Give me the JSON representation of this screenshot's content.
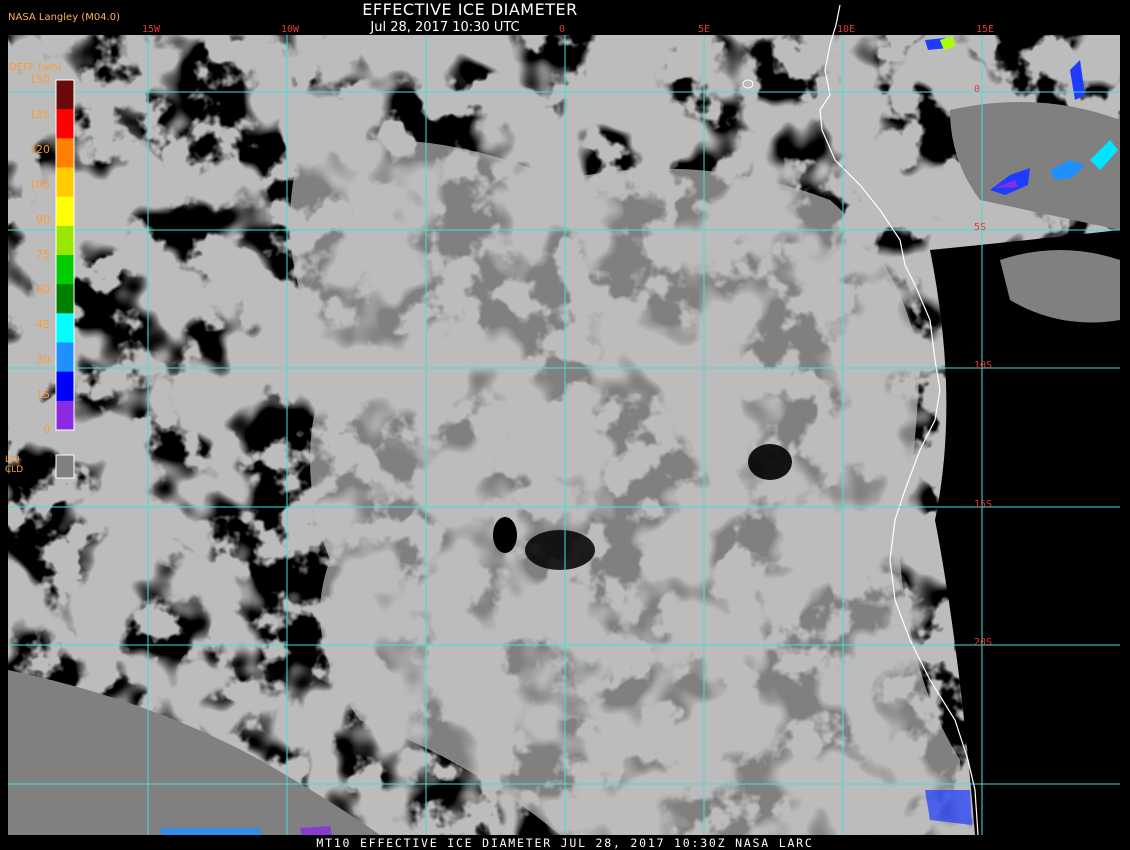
{
  "header": {
    "title": "EFFECTIVE ICE DIAMETER",
    "subtitle": "Jul 28, 2017 10:30 UTC",
    "org": "NASA Langley (M04.0)"
  },
  "legend": {
    "title": "DEFF (um)",
    "ticks": [
      "150",
      "135",
      "120",
      "105",
      "90",
      "75",
      "60",
      "45",
      "30",
      "15",
      "0"
    ],
    "colors": [
      "#6b0a0a",
      "#ff0000",
      "#ff7f00",
      "#ffcc00",
      "#ffff00",
      "#99e600",
      "#00cc00",
      "#008000",
      "#00ffff",
      "#1e90ff",
      "#0000ff",
      "#8a2be2"
    ],
    "liq_label_1": "LIQ",
    "liq_label_2": "CLD",
    "liq_color": "#808080"
  },
  "grid": {
    "lon_labels": [
      "15W",
      "10W",
      "0",
      "5E",
      "10E",
      "15E"
    ],
    "lat_labels": [
      "0",
      "5S",
      "10S",
      "15S",
      "20S"
    ],
    "line_color": "#40e0e0",
    "label_color": "#e03a3a"
  },
  "footer": "MT10  EFFECTIVE ICE DIAMETER  JUL 28, 2017 10:30Z  NASA LARC",
  "colors": {
    "cloud": "#808080",
    "coast": "#ffffff",
    "background": "#000000"
  }
}
